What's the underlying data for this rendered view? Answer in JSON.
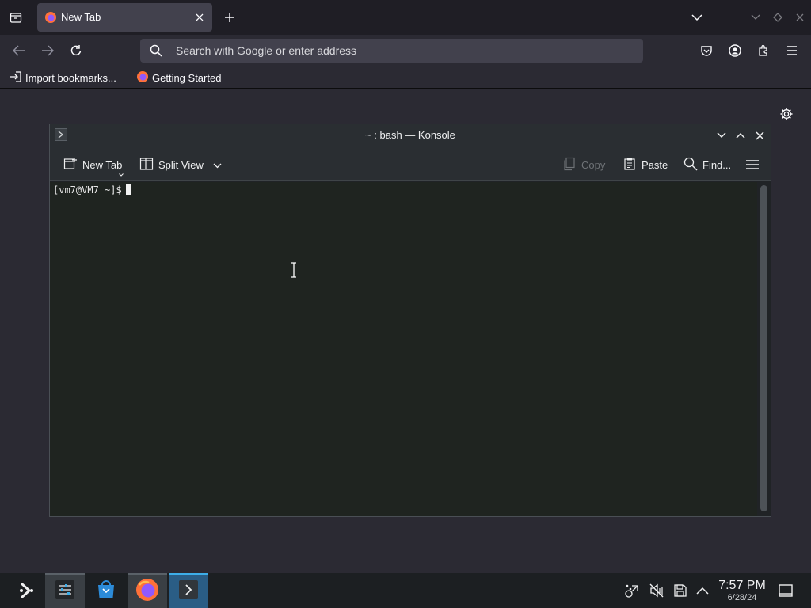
{
  "firefox": {
    "tab": {
      "title": "New Tab"
    },
    "urlbar": {
      "placeholder": "Search with Google or enter address"
    },
    "bookmarks": [
      {
        "label": "Import bookmarks...",
        "icon": "import-icon"
      },
      {
        "label": "Getting Started",
        "icon": "firefox-icon"
      }
    ]
  },
  "konsole": {
    "title": "~ : bash — Konsole",
    "toolbar": {
      "new_tab": "New Tab",
      "split_view": "Split View",
      "copy": "Copy",
      "paste": "Paste",
      "find": "Find..."
    },
    "prompt": "[vm7@VM7 ~]$"
  },
  "taskbar": {
    "time": "7:57 PM",
    "date": "6/28/24"
  },
  "colors": {
    "accent": "#3daee9",
    "terminal_bg": "#1f2420"
  }
}
